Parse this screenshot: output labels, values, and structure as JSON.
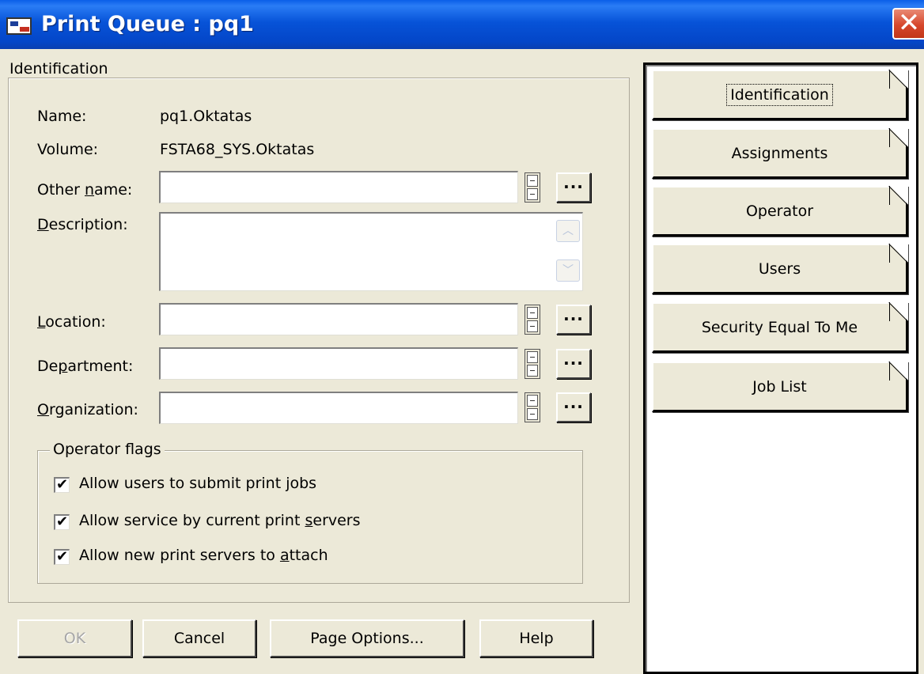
{
  "window": {
    "title": "Print Queue : pq1",
    "close_glyph": "✕"
  },
  "identification": {
    "group_label": "Identification",
    "name_label": "Name:",
    "name_value": "pq1.Oktatas",
    "volume_label": "Volume:",
    "volume_value": "FSTA68_SYS.Oktatas",
    "other_name_label_pre": "Other ",
    "other_name_label_key": "n",
    "other_name_label_post": "ame:",
    "other_name_value": "",
    "description_label_key": "D",
    "description_label_post": "escription:",
    "description_value": "",
    "location_label_key": "L",
    "location_label_post": "ocation:",
    "location_value": "",
    "department_label_pre": "De",
    "department_label_key": "p",
    "department_label_post": "artment:",
    "department_value": "",
    "organization_label_key": "O",
    "organization_label_post": "rganization:",
    "organization_value": "",
    "browse_glyph": "..."
  },
  "operator_flags": {
    "legend": "Operator flags",
    "items": [
      {
        "pre": "Allow users to submit print jobs",
        "key": "",
        "post": "",
        "checked": true
      },
      {
        "pre": "Allow service by current print ",
        "key": "s",
        "post": "ervers",
        "checked": true
      },
      {
        "pre": "Allow new print servers to ",
        "key": "a",
        "post": "ttach",
        "checked": true
      }
    ],
    "check_glyph": "✔"
  },
  "page_tabs": [
    {
      "label": "Identification",
      "active": true
    },
    {
      "label": "Assignments",
      "active": false
    },
    {
      "label": "Operator",
      "active": false
    },
    {
      "label": "Users",
      "active": false
    },
    {
      "label": "Security Equal To Me",
      "active": false
    },
    {
      "label": "Job List",
      "active": false
    }
  ],
  "buttons": {
    "ok": "OK",
    "cancel": "Cancel",
    "page_options": "Page Options...",
    "help": "Help"
  }
}
